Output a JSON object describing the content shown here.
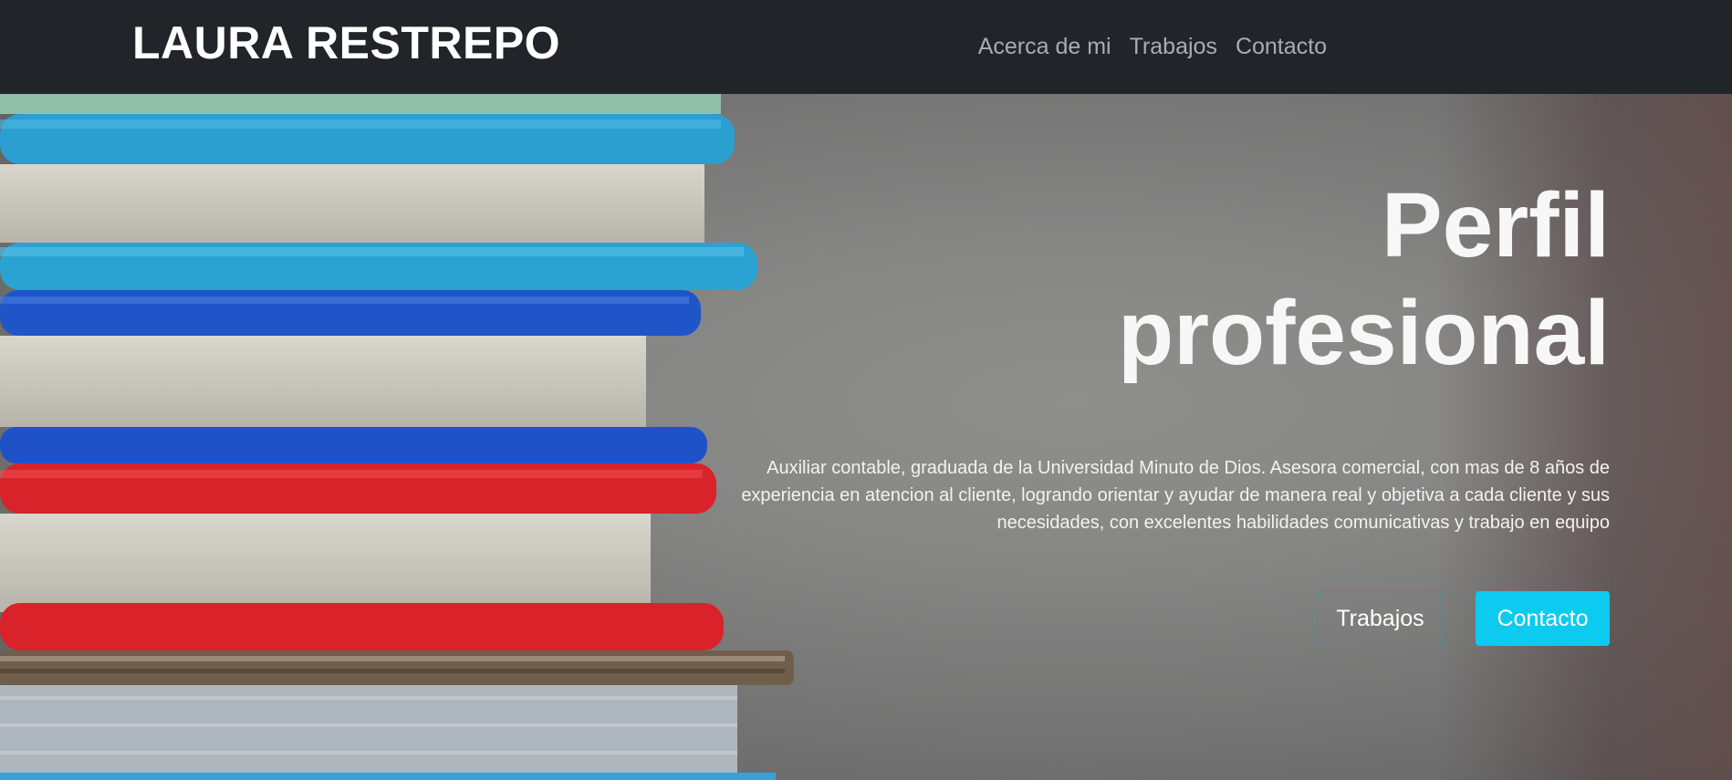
{
  "brand": {
    "name": "LAURA RESTREPO"
  },
  "nav": {
    "items": [
      {
        "label": "Acerca de mi"
      },
      {
        "label": "Trabajos"
      },
      {
        "label": "Contacto"
      }
    ]
  },
  "hero": {
    "title_line1": "Perfil",
    "title_line2": "profesional",
    "description": "Auxiliar contable, graduada de la Universidad Minuto de Dios. Asesora comercial, con mas de 8 años de experiencia en atencion al cliente, logrando orientar y ayudar de manera real y objetiva a cada cliente y sus necesidades, con excelentes habilidades comunicativas y trabajo en equipo",
    "buttons": [
      {
        "label": "Trabajos"
      },
      {
        "label": "Contacto"
      }
    ]
  },
  "colors": {
    "navbar_bg": "#212529",
    "accent_cyan": "#0dcaf0",
    "outline_border": "#17a2b8",
    "nav_link": "#a9adb2"
  }
}
